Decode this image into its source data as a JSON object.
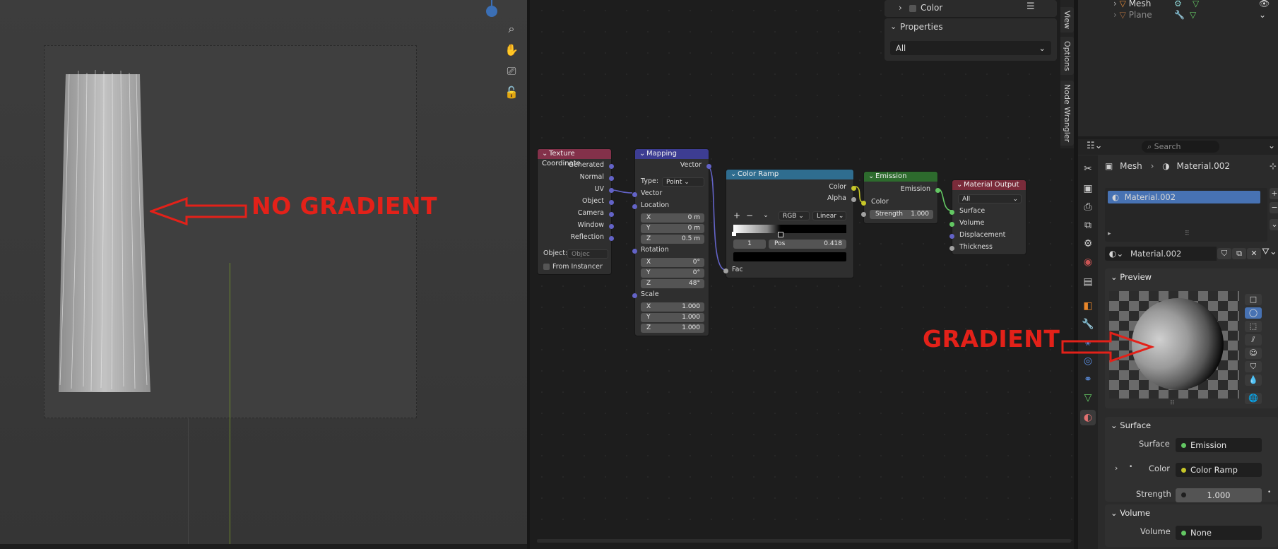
{
  "annotations": {
    "left_label": "NO GRADIENT",
    "right_label": "GRADIENT",
    "color": "#e32119"
  },
  "viewport": {
    "nav_icons": [
      "zoom-icon",
      "hand-pan-icon",
      "camera-icon",
      "lock-icon"
    ]
  },
  "nodes": {
    "texcoord": {
      "title": "Texture Coordinate",
      "outputs": [
        "Generated",
        "Normal",
        "UV",
        "Object",
        "Camera",
        "Window",
        "Reflection"
      ],
      "object_label": "Object:",
      "object_placeholder": "Objec",
      "from_instancer": "From Instancer"
    },
    "mapping": {
      "title": "Mapping",
      "output": "Vector",
      "type_label": "Type:",
      "type_value": "Point",
      "vector_label": "Vector",
      "location_label": "Location",
      "location": [
        {
          "axis": "X",
          "val": "0 m"
        },
        {
          "axis": "Y",
          "val": "0 m"
        },
        {
          "axis": "Z",
          "val": "0.5 m"
        }
      ],
      "rotation_label": "Rotation",
      "rotation": [
        {
          "axis": "X",
          "val": "0°"
        },
        {
          "axis": "Y",
          "val": "0°"
        },
        {
          "axis": "Z",
          "val": "48°"
        }
      ],
      "scale_label": "Scale",
      "scale": [
        {
          "axis": "X",
          "val": "1.000"
        },
        {
          "axis": "Y",
          "val": "1.000"
        },
        {
          "axis": "Z",
          "val": "1.000"
        }
      ]
    },
    "colorramp": {
      "title": "Color Ramp",
      "out_color": "Color",
      "out_alpha": "Alpha",
      "add": "+",
      "remove": "−",
      "mode": "RGB",
      "interp": "Linear",
      "index": "1",
      "pos_label": "Pos",
      "pos_value": "0.418",
      "input": "Fac"
    },
    "emission": {
      "title": "Emission",
      "output": "Emission",
      "color_label": "Color",
      "strength_label": "Strength",
      "strength_value": "1.000"
    },
    "output": {
      "title": "Material Output",
      "target": "All",
      "inputs": [
        "Surface",
        "Volume",
        "Displacement",
        "Thickness"
      ]
    }
  },
  "npanel": {
    "color_row": "Color",
    "properties_header": "Properties",
    "properties_value": "All",
    "tabs": [
      "View",
      "Options",
      "Node Wrangler"
    ]
  },
  "outliner": {
    "rows": [
      "Mesh",
      "Plane"
    ]
  },
  "properties": {
    "search_placeholder": "Search",
    "breadcrumb_object": "Mesh",
    "breadcrumb_material": "Material.002",
    "slot_name": "Material.002",
    "material_name": "Material.002",
    "preview_header": "Preview",
    "surface_header": "Surface",
    "surface_label": "Surface",
    "surface_value": "Emission",
    "color_label": "Color",
    "color_value": "Color Ramp",
    "strength_label": "Strength",
    "strength_value": "1.000",
    "volume_header": "Volume",
    "volume_label": "Volume",
    "volume_value": "None"
  }
}
